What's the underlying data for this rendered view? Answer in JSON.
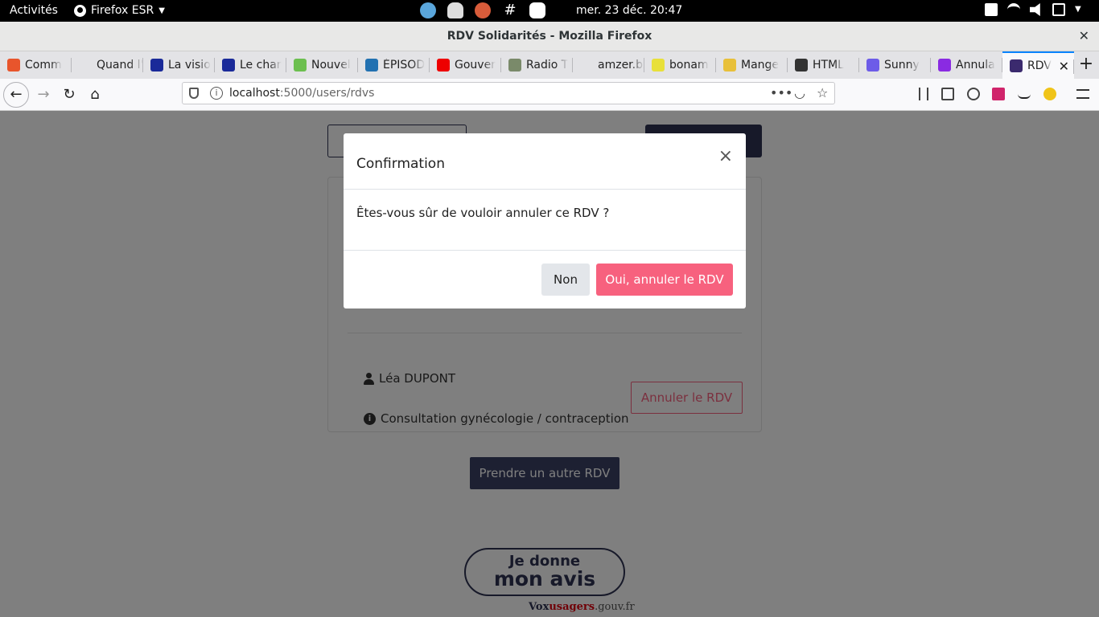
{
  "desktop": {
    "activities": "Activités",
    "app_name": "Firefox ESR",
    "clock": "mer. 23 déc.  20:47"
  },
  "window": {
    "title": "RDV Solidarités - Mozilla Firefox"
  },
  "tabs": [
    {
      "label": "Comm",
      "color": "#e8552c"
    },
    {
      "label": "Quand l'É",
      "color": "#e3e3e6"
    },
    {
      "label": "La visio",
      "color": "#1a2a99"
    },
    {
      "label": "Le char",
      "color": "#1a2a99"
    },
    {
      "label": "Nouvel",
      "color": "#6cbf4f"
    },
    {
      "label": "ÉPISOD",
      "color": "#2271b1"
    },
    {
      "label": "Gouver",
      "color": "#e00"
    },
    {
      "label": "Radio T",
      "color": "#7a8a6a"
    },
    {
      "label": "amzer.bzh",
      "color": "#e3e3e6"
    },
    {
      "label": "bonam",
      "color": "#e8e03a"
    },
    {
      "label": "Mange",
      "color": "#e8c03a"
    },
    {
      "label": "HTML",
      "color": "#333"
    },
    {
      "label": "Sunny",
      "color": "#6d5ce8"
    },
    {
      "label": "Annula",
      "color": "#8a2be2"
    },
    {
      "label": "RDV",
      "color": "#3b2a6e",
      "active": true
    }
  ],
  "navbar": {
    "url_host": "localhost",
    "url_path": ":5000/users/rdvs"
  },
  "page": {
    "user_name": "Léa DUPONT",
    "motif": "Consultation gynécologie / contraception",
    "cancel_button": "Annuler le RDV",
    "other_rdv_button": "Prendre un autre RDV",
    "vox_line1": "Je donne",
    "vox_line2": "mon avis",
    "vox_site_a": "Vox",
    "vox_site_b": "usagers",
    "vox_site_c": ".gouv.fr"
  },
  "modal": {
    "title": "Confirmation",
    "close": "×",
    "message": "Êtes-vous sûr de vouloir annuler ce RDV ?",
    "no_button": "Non",
    "yes_button": "Oui, annuler le RDV"
  }
}
